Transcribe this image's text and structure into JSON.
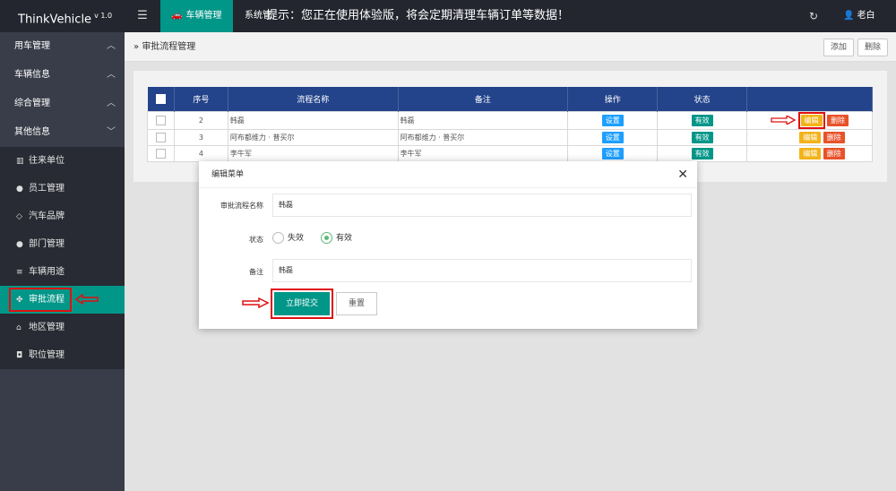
{
  "app": {
    "brand": "ThinkVehicle",
    "version": "v 1.0"
  },
  "topbar": {
    "active_tab": "车辆管理",
    "second_tab": "系统管",
    "notice": "提示：您正在使用体验版，将会定期清理车辆订单等数据！",
    "user": "老白"
  },
  "sidebar": {
    "groups": [
      {
        "label": "用车管理"
      },
      {
        "label": "车辆信息"
      },
      {
        "label": "综合管理"
      },
      {
        "label": "其他信息"
      }
    ],
    "items": [
      {
        "label": "往来单位",
        "icon": "bank-icon"
      },
      {
        "label": "员工管理",
        "icon": "user-icon"
      },
      {
        "label": "汽车品牌",
        "icon": "diamond-icon"
      },
      {
        "label": "部门管理",
        "icon": "users-icon"
      },
      {
        "label": "车辆用途",
        "icon": "list-icon"
      },
      {
        "label": "审批流程",
        "icon": "gear-icon"
      },
      {
        "label": "地区管理",
        "icon": "home-icon"
      },
      {
        "label": "职位管理",
        "icon": "camera-icon"
      }
    ]
  },
  "main": {
    "breadcrumb": "审批流程管理",
    "add_label": "添加",
    "delete_label": "删除"
  },
  "table": {
    "headers": [
      "序号",
      "流程名称",
      "备注",
      "操作",
      "状态"
    ],
    "rows": [
      {
        "no": "2",
        "name": "韩磊",
        "remark": "韩磊",
        "op": "设置",
        "status": "有效",
        "edit": "编辑",
        "del": "删除"
      },
      {
        "no": "3",
        "name": "阿布都维力 · 普买尔",
        "remark": "阿布都维力 · 普买尔",
        "op": "设置",
        "status": "有效",
        "edit": "编辑",
        "del": "删除"
      },
      {
        "no": "4",
        "name": "李牛军",
        "remark": "李牛军",
        "op": "设置",
        "status": "有效",
        "edit": "编辑",
        "del": "删除"
      }
    ]
  },
  "modal": {
    "title": "编辑菜单",
    "close": "✕",
    "name_label": "审批流程名称",
    "name_value": "韩磊",
    "status_label": "状态",
    "status_off": "失效",
    "status_on": "有效",
    "remark_label": "备注",
    "remark_value": "韩磊",
    "submit": "立即提交",
    "reset": "重置"
  },
  "colors": {
    "accent": "#009688",
    "header": "#23438a",
    "highlight": "#e01010"
  }
}
